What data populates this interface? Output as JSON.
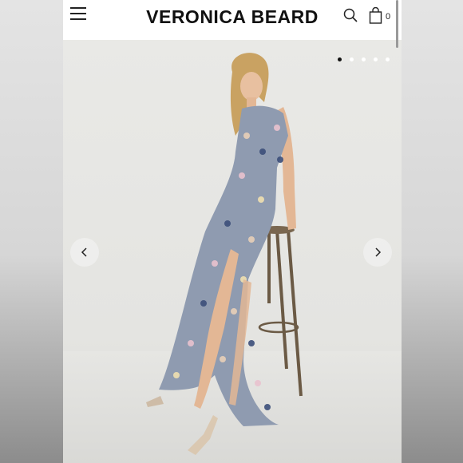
{
  "header": {
    "brand": "VERONICA BEARD",
    "cart_count": "0",
    "icons": [
      "hamburger-menu-icon",
      "search-icon",
      "shopping-bag-icon"
    ]
  },
  "gallery": {
    "slide_count": 5,
    "active_index": 0,
    "icons": [
      "chevron-left-icon",
      "chevron-right-icon"
    ]
  },
  "colors": {
    "background": "#ffffff",
    "text": "#111111",
    "dot_active": "#111111",
    "dot_inactive": "#ffffff"
  }
}
